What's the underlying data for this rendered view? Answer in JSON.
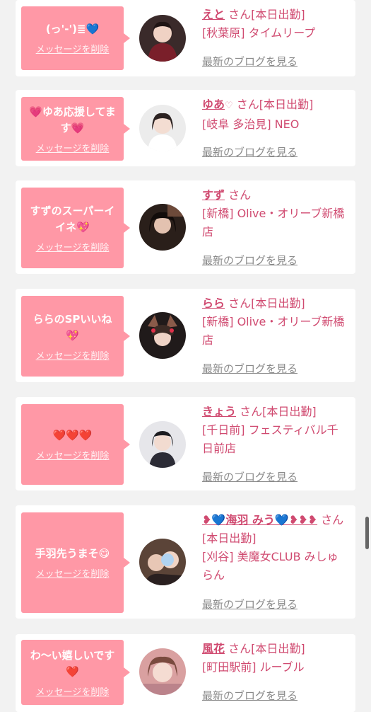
{
  "delete_label": "メッセージを削除",
  "blog_label": "最新のブログを見る",
  "accent_color": "#ff98a6",
  "items": [
    {
      "message": "(っ'-')≣💙",
      "name": "えと",
      "suffix": "さん[本日出勤]",
      "shop": "[秋葉原] タイムリープ"
    },
    {
      "message": "💗ゆあ応援してます💗",
      "name": "ゆあ",
      "name_mark": "♡",
      "suffix": "さん[本日出勤]",
      "shop": "[岐阜 多治見] NEO"
    },
    {
      "message": "すずのスーパーイイネ💖",
      "name": "すず",
      "suffix": "さん",
      "shop": "[新橋] Olive・オリーブ新橋店"
    },
    {
      "message": "ららのSPいいね💖",
      "name": "らら",
      "suffix": "さん[本日出勤]",
      "shop": "[新橋] Olive・オリーブ新橋店"
    },
    {
      "message": "❤️❤️❤️",
      "name": "きょう",
      "suffix": "さん[本日出勤]",
      "shop": "[千日前] フェスティバル千日前店"
    },
    {
      "message": "手羽先うまそ😋",
      "name": "❥💙海羽 みう💙❥❥❥",
      "suffix": "さん[本日出勤]",
      "shop": "[刈谷] 美魔女CLUB みしゅらん"
    },
    {
      "message": "わ〜い嬉しいです❤️",
      "name": "風花",
      "suffix": "さん[本日出勤]",
      "shop": "[町田駅前] ルーブル"
    }
  ]
}
